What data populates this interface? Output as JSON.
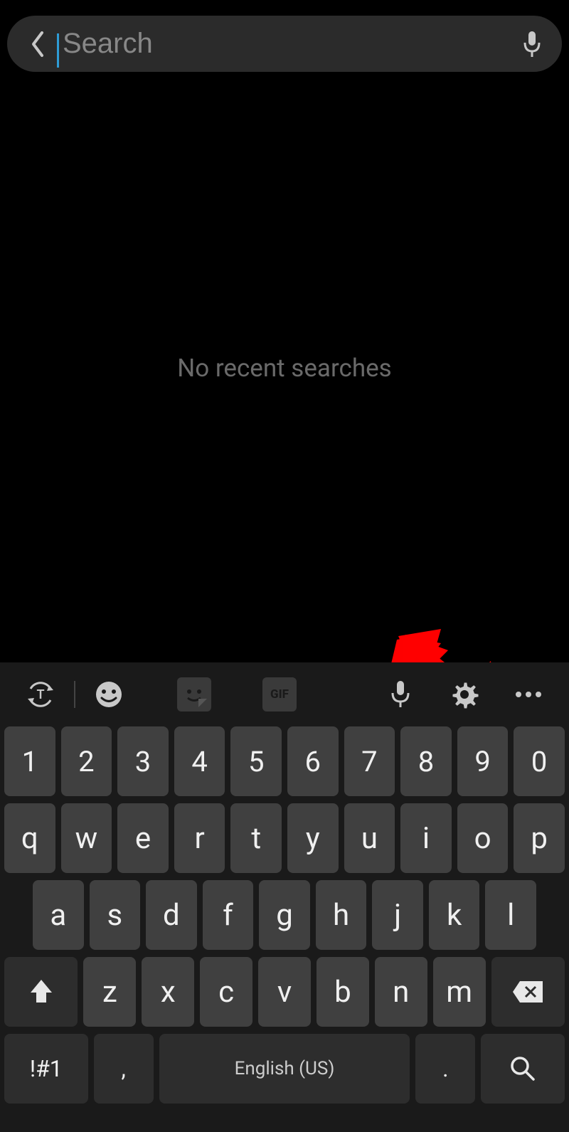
{
  "search": {
    "placeholder": "Search",
    "value": ""
  },
  "content": {
    "empty_message": "No recent searches"
  },
  "keyboard": {
    "toolbar": {
      "gif_label": "GIF"
    },
    "row1": [
      "1",
      "2",
      "3",
      "4",
      "5",
      "6",
      "7",
      "8",
      "9",
      "0"
    ],
    "row2": [
      "q",
      "w",
      "e",
      "r",
      "t",
      "y",
      "u",
      "i",
      "o",
      "p"
    ],
    "row3": [
      "a",
      "s",
      "d",
      "f",
      "g",
      "h",
      "j",
      "k",
      "l"
    ],
    "row4": [
      "z",
      "x",
      "c",
      "v",
      "b",
      "n",
      "m"
    ],
    "sym_label": "!#1",
    "comma": ",",
    "period": ".",
    "space_label": "English (US)"
  }
}
